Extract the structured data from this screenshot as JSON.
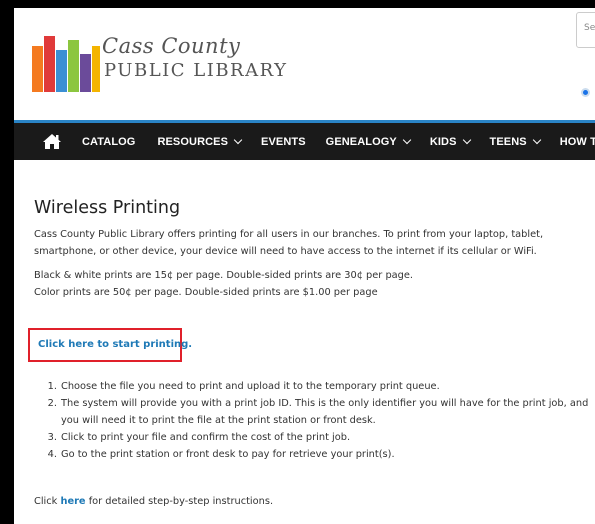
{
  "header": {
    "logo_title": "Cass County",
    "logo_subtitle": "PUBLIC LIBRARY",
    "search_placeholder": "Se"
  },
  "nav": {
    "items": [
      {
        "label": "CATALOG",
        "dropdown": false
      },
      {
        "label": "RESOURCES",
        "dropdown": true
      },
      {
        "label": "EVENTS",
        "dropdown": false
      },
      {
        "label": "GENEALOGY",
        "dropdown": true
      },
      {
        "label": "KIDS",
        "dropdown": true
      },
      {
        "label": "TEENS",
        "dropdown": true
      },
      {
        "label": "HOW TO...",
        "dropdown": false
      }
    ]
  },
  "main": {
    "title": "Wireless Printing",
    "intro": "Cass County Public Library offers printing for all users in our branches. To print from your laptop, tablet, smartphone, or other device, your device will need to have access to the internet if its cellular or WiFi.",
    "price_bw": "Black & white prints are 15¢ per page. Double-sided prints are 30¢ per page.",
    "price_color": "Color prints are 50¢ per page. Double-sided prints are $1.00 per page",
    "cta_link": "Click here to start printing.",
    "steps": [
      {
        "num": "1.",
        "text": "Choose the file you need to print and upload it to the temporary print queue."
      },
      {
        "num": "2.",
        "text": "The system will provide you with a print job ID. This is the only identifier you will have for the print job, and you will need it to print the file at the print station or front desk."
      },
      {
        "num": "3.",
        "text": "Click to print your file and confirm the cost of the print job."
      },
      {
        "num": "4.",
        "text": "Go to the print station or front desk to pay for retrieve your print(s)."
      }
    ],
    "footer_prefix": "Click ",
    "footer_link": "here",
    "footer_suffix": " for detailed step-by-step instructions."
  },
  "colors": {
    "nav_bg": "#1a1a1a",
    "nav_accent": "#2a84c6",
    "link": "#1e79b6",
    "highlight_box": "#e0202a",
    "logo_bars": [
      "#f47a20",
      "#e03a3a",
      "#3b8fd4",
      "#8cc63f",
      "#6b4b9a",
      "#f4b400"
    ]
  },
  "icons": {
    "home": "home-icon"
  }
}
